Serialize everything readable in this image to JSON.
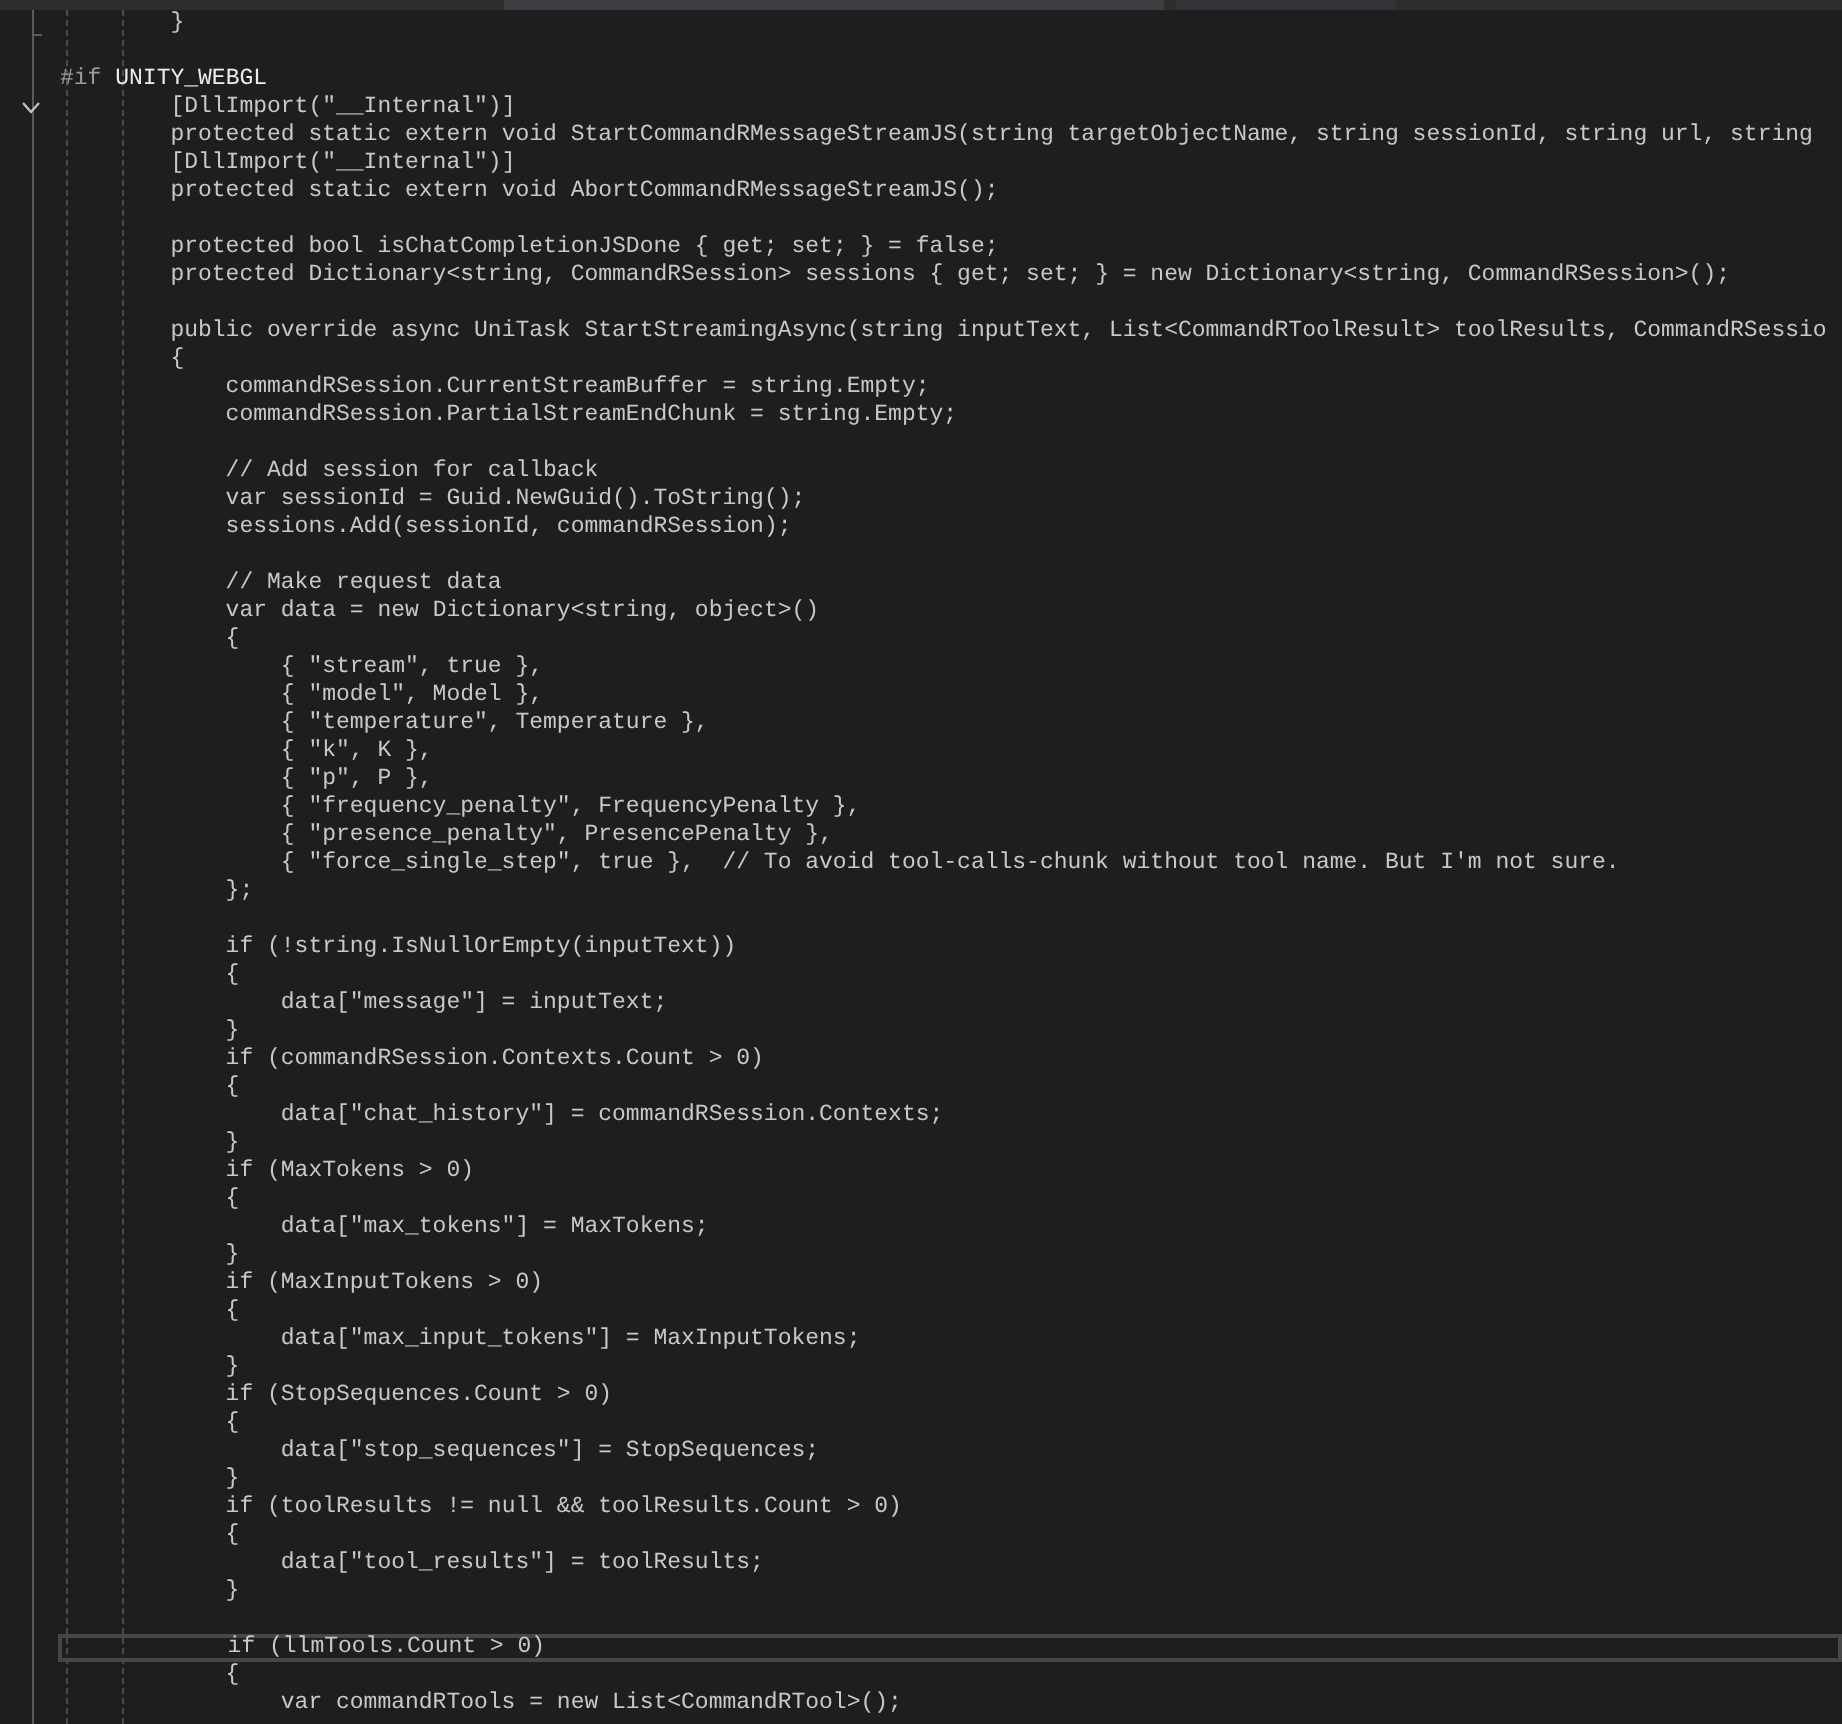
{
  "tabs": [
    {
      "selected": true
    },
    {
      "selected": false
    }
  ],
  "lines": [
    {
      "kind": "code",
      "text": "        }"
    },
    {
      "kind": "blank"
    },
    {
      "kind": "directive",
      "directive": "#if",
      "symbol": "UNITY_WEBGL"
    },
    {
      "kind": "code",
      "text": "        [DllImport(\"__Internal\")]",
      "expanded": true
    },
    {
      "kind": "code",
      "text": "        protected static extern void StartCommandRMessageStreamJS(string targetObjectName, string sessionId, string url, string"
    },
    {
      "kind": "code",
      "text": "        [DllImport(\"__Internal\")]"
    },
    {
      "kind": "code",
      "text": "        protected static extern void AbortCommandRMessageStreamJS();"
    },
    {
      "kind": "blank"
    },
    {
      "kind": "code",
      "text": "        protected bool isChatCompletionJSDone { get; set; } = false;"
    },
    {
      "kind": "code",
      "text": "        protected Dictionary<string, CommandRSession> sessions { get; set; } = new Dictionary<string, CommandRSession>();"
    },
    {
      "kind": "blank"
    },
    {
      "kind": "code",
      "text": "        public override async UniTask StartStreamingAsync(string inputText, List<CommandRToolResult> toolResults, CommandRSessio"
    },
    {
      "kind": "code",
      "text": "        {"
    },
    {
      "kind": "code",
      "text": "            commandRSession.CurrentStreamBuffer = string.Empty;"
    },
    {
      "kind": "code",
      "text": "            commandRSession.PartialStreamEndChunk = string.Empty;"
    },
    {
      "kind": "blank"
    },
    {
      "kind": "code",
      "text": "            // Add session for callback"
    },
    {
      "kind": "code",
      "text": "            var sessionId = Guid.NewGuid().ToString();"
    },
    {
      "kind": "code",
      "text": "            sessions.Add(sessionId, commandRSession);"
    },
    {
      "kind": "blank"
    },
    {
      "kind": "code",
      "text": "            // Make request data"
    },
    {
      "kind": "code",
      "text": "            var data = new Dictionary<string, object>()"
    },
    {
      "kind": "code",
      "text": "            {"
    },
    {
      "kind": "code",
      "text": "                { \"stream\", true },"
    },
    {
      "kind": "code",
      "text": "                { \"model\", Model },"
    },
    {
      "kind": "code",
      "text": "                { \"temperature\", Temperature },"
    },
    {
      "kind": "code",
      "text": "                { \"k\", K },"
    },
    {
      "kind": "code",
      "text": "                { \"p\", P },"
    },
    {
      "kind": "code",
      "text": "                { \"frequency_penalty\", FrequencyPenalty },"
    },
    {
      "kind": "code",
      "text": "                { \"presence_penalty\", PresencePenalty },"
    },
    {
      "kind": "code",
      "text": "                { \"force_single_step\", true },  // To avoid tool-calls-chunk without tool name. But I'm not sure."
    },
    {
      "kind": "code",
      "text": "            };"
    },
    {
      "kind": "blank"
    },
    {
      "kind": "code",
      "text": "            if (!string.IsNullOrEmpty(inputText))"
    },
    {
      "kind": "code",
      "text": "            {"
    },
    {
      "kind": "code",
      "text": "                data[\"message\"] = inputText;"
    },
    {
      "kind": "code",
      "text": "            }"
    },
    {
      "kind": "code",
      "text": "            if (commandRSession.Contexts.Count > 0)"
    },
    {
      "kind": "code",
      "text": "            {"
    },
    {
      "kind": "code",
      "text": "                data[\"chat_history\"] = commandRSession.Contexts;"
    },
    {
      "kind": "code",
      "text": "            }"
    },
    {
      "kind": "code",
      "text": "            if (MaxTokens > 0)"
    },
    {
      "kind": "code",
      "text": "            {"
    },
    {
      "kind": "code",
      "text": "                data[\"max_tokens\"] = MaxTokens;"
    },
    {
      "kind": "code",
      "text": "            }"
    },
    {
      "kind": "code",
      "text": "            if (MaxInputTokens > 0)"
    },
    {
      "kind": "code",
      "text": "            {"
    },
    {
      "kind": "code",
      "text": "                data[\"max_input_tokens\"] = MaxInputTokens;"
    },
    {
      "kind": "code",
      "text": "            }"
    },
    {
      "kind": "code",
      "text": "            if (StopSequences.Count > 0)"
    },
    {
      "kind": "code",
      "text": "            {"
    },
    {
      "kind": "code",
      "text": "                data[\"stop_sequences\"] = StopSequences;"
    },
    {
      "kind": "code",
      "text": "            }"
    },
    {
      "kind": "code",
      "text": "            if (toolResults != null && toolResults.Count > 0)"
    },
    {
      "kind": "code",
      "text": "            {"
    },
    {
      "kind": "code",
      "text": "                data[\"tool_results\"] = toolResults;"
    },
    {
      "kind": "code",
      "text": "            }"
    },
    {
      "kind": "blank"
    },
    {
      "kind": "code",
      "text": "            if (llmTools.Count > 0)",
      "current": true
    },
    {
      "kind": "code",
      "text": "            {"
    },
    {
      "kind": "code",
      "text": "                var commandRTools = new List<CommandRTool>();"
    }
  ]
}
